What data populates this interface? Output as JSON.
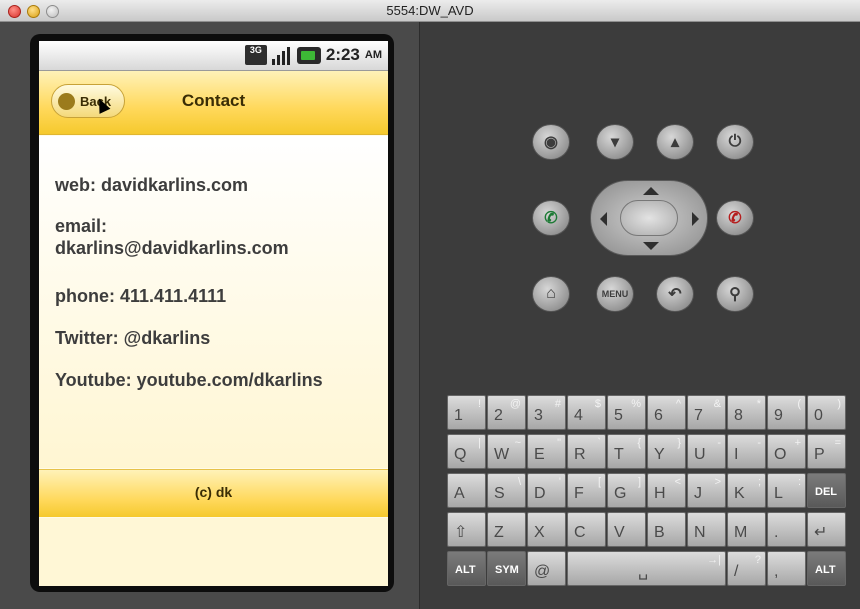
{
  "window": {
    "title": "5554:DW_AVD"
  },
  "statusbar": {
    "network": "3G",
    "time": "2:23",
    "ampm": "AM"
  },
  "header": {
    "back_label": "Back",
    "title": "Contact"
  },
  "contact": {
    "web": "web: davidkarlins.com",
    "email_label": "email:",
    "email_value": "dkarlins@davidkarlins.com",
    "phone": "phone: 411.411.4111",
    "twitter": "Twitter: @dkarlins",
    "youtube": "Youtube: youtube.com/dkarlins"
  },
  "footer": {
    "text": "(c) dk"
  },
  "controls": {
    "menu_label": "MENU",
    "icons": [
      "camera-icon",
      "volume-down-icon",
      "volume-up-icon",
      "power-icon",
      "call-icon",
      "end-call-icon",
      "home-icon",
      "menu-button",
      "back-icon",
      "search-icon"
    ]
  },
  "keyboard": {
    "row1": [
      {
        "k": "1",
        "s": "!"
      },
      {
        "k": "2",
        "s": "@"
      },
      {
        "k": "3",
        "s": "#"
      },
      {
        "k": "4",
        "s": "$"
      },
      {
        "k": "5",
        "s": "%"
      },
      {
        "k": "6",
        "s": "^"
      },
      {
        "k": "7",
        "s": "&"
      },
      {
        "k": "8",
        "s": "*"
      },
      {
        "k": "9",
        "s": "("
      },
      {
        "k": "0",
        "s": ")"
      }
    ],
    "row2": [
      {
        "k": "Q",
        "s": "|"
      },
      {
        "k": "W",
        "s": "~"
      },
      {
        "k": "E",
        "s": "\""
      },
      {
        "k": "R",
        "s": "`"
      },
      {
        "k": "T",
        "s": "{"
      },
      {
        "k": "Y",
        "s": "}"
      },
      {
        "k": "U",
        "s": "-"
      },
      {
        "k": "I",
        "s": "-"
      },
      {
        "k": "O",
        "s": "+"
      },
      {
        "k": "P",
        "s": "="
      }
    ],
    "row3": [
      {
        "k": "A",
        "s": ""
      },
      {
        "k": "S",
        "s": "\\"
      },
      {
        "k": "D",
        "s": "'"
      },
      {
        "k": "F",
        "s": "["
      },
      {
        "k": "G",
        "s": "]"
      },
      {
        "k": "H",
        "s": "<"
      },
      {
        "k": "J",
        "s": ">"
      },
      {
        "k": "K",
        "s": ";"
      },
      {
        "k": "L",
        "s": ":"
      },
      {
        "k": "DEL",
        "s": ""
      }
    ],
    "row4": [
      {
        "k": "⇧",
        "s": ""
      },
      {
        "k": "Z",
        "s": ""
      },
      {
        "k": "X",
        "s": ""
      },
      {
        "k": "C",
        "s": ""
      },
      {
        "k": "V",
        "s": ""
      },
      {
        "k": "B",
        "s": ""
      },
      {
        "k": "N",
        "s": ""
      },
      {
        "k": "M",
        "s": ""
      },
      {
        "k": ".",
        "s": ""
      },
      {
        "k": "↵",
        "s": ""
      }
    ],
    "row5": [
      {
        "k": "ALT",
        "s": ""
      },
      {
        "k": "SYM",
        "s": ""
      },
      {
        "k": "@",
        "s": ""
      },
      {
        "k": "␣",
        "s": "→|"
      },
      {
        "k": "/",
        "s": "?"
      },
      {
        "k": ",",
        "s": ""
      },
      {
        "k": "ALT",
        "s": ""
      }
    ]
  }
}
